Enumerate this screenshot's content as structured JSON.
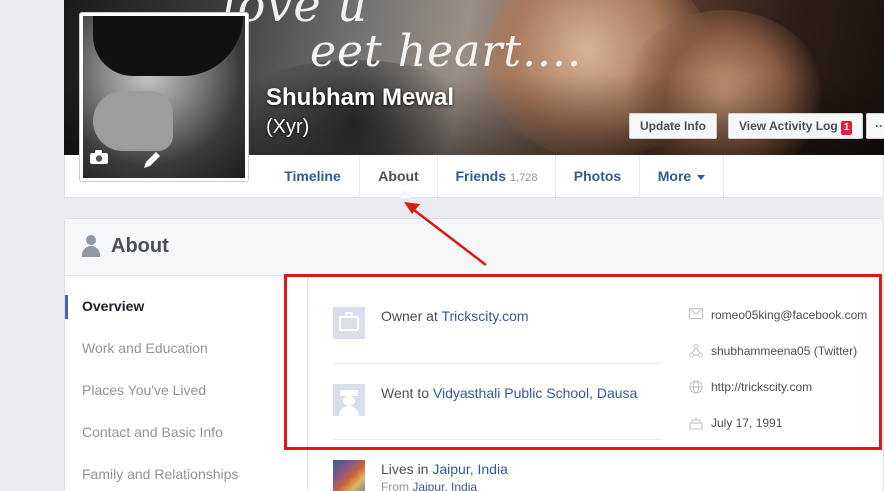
{
  "cover": {
    "overlay_text_line1": "love u",
    "overlay_text_line2": "eet heart...."
  },
  "profile": {
    "name": "Shubham Mewal",
    "alternate_name": "(Xyr)"
  },
  "cover_buttons": {
    "update_info": "Update Info",
    "view_activity_log": "View Activity Log",
    "activity_badge": "1",
    "more": "···"
  },
  "tabs": [
    {
      "label": "Timeline",
      "count": ""
    },
    {
      "label": "About",
      "count": ""
    },
    {
      "label": "Friends",
      "count": "1,728"
    },
    {
      "label": "Photos",
      "count": ""
    },
    {
      "label": "More",
      "count": ""
    }
  ],
  "about": {
    "title": "About",
    "sidebar": [
      "Overview",
      "Work and Education",
      "Places You've Lived",
      "Contact and Basic Info",
      "Family and Relationships"
    ],
    "work": {
      "prefix": "Owner at ",
      "link": "Trickscity.com"
    },
    "education": {
      "prefix": "Went to ",
      "link": "Vidyasthali Public School, Dausa"
    },
    "lives": {
      "prefix": "Lives in ",
      "link": "Jaipur, India",
      "from_prefix": "From ",
      "from_link": "Jaipur, India"
    },
    "contact": {
      "email": "romeo05king@facebook.com",
      "twitter_handle": "shubhammeena05",
      "twitter_label": "(Twitter)",
      "website": "http://trickscity.com",
      "birthday": "July 17, 1991"
    }
  },
  "colors": {
    "link": "#365899",
    "annotation": "#e01717",
    "page_bg": "#e9ebee"
  }
}
